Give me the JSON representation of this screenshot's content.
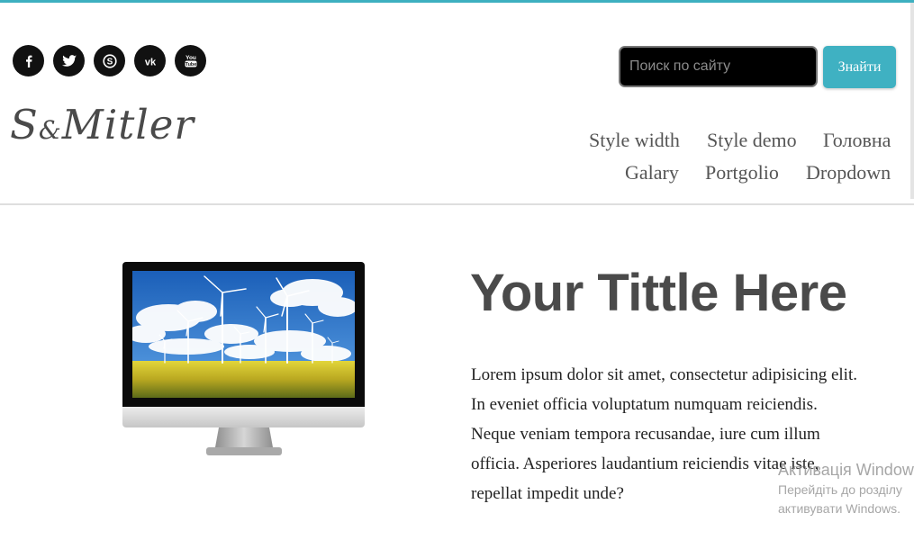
{
  "header": {
    "accent_color": "#3db0c0",
    "social_icons": [
      "facebook-icon",
      "twitter-icon",
      "skype-icon",
      "vk-icon",
      "youtube-icon"
    ],
    "search": {
      "placeholder": "Поиск по сайту",
      "value": "",
      "button_label": "Знайти",
      "button_color": "#3fb1c2"
    },
    "logo": {
      "main": "S",
      "amp": "&",
      "rest": "Mitler"
    },
    "nav": {
      "row1": [
        "Style width",
        "Style demo",
        "Головна"
      ],
      "row2": [
        "Galary",
        "Portgolio",
        "Dropdown"
      ]
    }
  },
  "hero": {
    "title": "Your Tittle Here",
    "body": "Lorem ipsum dolor sit amet, consectetur adipisicing elit. In eveniet officia voluptatum numquam reiciendis. Neque veniam tempora recusandae, iure cum illum officia. Asperiores laudantium reiciendis vitae iste, repellat impedit unde?"
  },
  "windows_watermark": {
    "title": "Активація Windows",
    "line1": "Перейдіть до розділу",
    "line2": "активувати Windows."
  }
}
